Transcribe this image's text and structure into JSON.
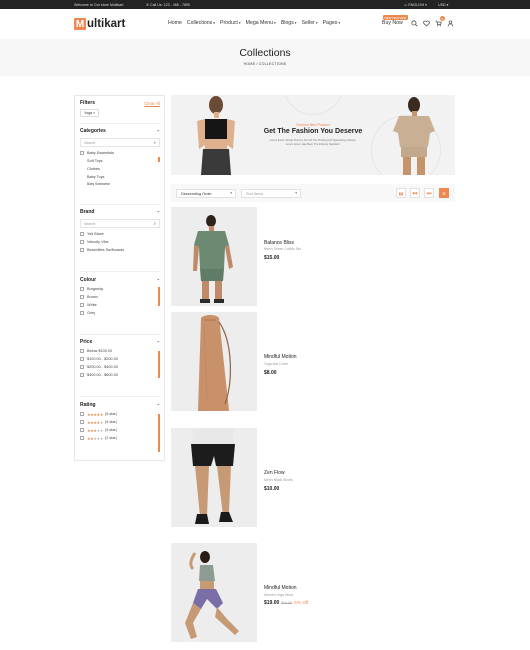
{
  "topbar": {
    "welcome": "Welcome to Our store Multikart",
    "call": "Call Us: 123 - 456 - 7890",
    "language": "ENGLISH",
    "currency": "USD"
  },
  "header": {
    "logo_mark": "M",
    "logo_text": "ultikart",
    "nav": [
      "Home",
      "Collections",
      "Product",
      "Mega Menu",
      "Blogs",
      "Seller",
      "Pages"
    ],
    "new_badge": "NEW FEATURE",
    "buy_now": "Buy Now",
    "cart_count": "0"
  },
  "page_title": "Collections",
  "breadcrumb": "HOME / COLLECTIONS",
  "filters": {
    "title": "Filters",
    "clear_all": "Clear All",
    "active_chip": "Yoga",
    "categories": {
      "title": "Categories",
      "search_placeholder": "Search",
      "items": [
        "Baby Essentials",
        "Soft Toys",
        "Clothes",
        "Baby Toys",
        "Baby Swimwear"
      ]
    },
    "brand": {
      "title": "Brand",
      "search_placeholder": "Search",
      "items": [
        "Yoti Blaze",
        "Velocity Vibe",
        "Beachlites Surfboards"
      ]
    },
    "colour": {
      "title": "Colour",
      "items": [
        "Burgundy",
        "Brown",
        "White",
        "Grey"
      ]
    },
    "price": {
      "title": "Price",
      "items": [
        "Below $100.00",
        "$100.00 - $200.00",
        "$200.00 - $400.00",
        "$400.00 - $600.00"
      ]
    },
    "rating": {
      "title": "Rating",
      "items": [
        {
          "label": "(5 star)",
          "stars": 5
        },
        {
          "label": "(4 star)",
          "stars": 4
        },
        {
          "label": "(3 star)",
          "stars": 3
        },
        {
          "label": "(2 star)",
          "stars": 2
        }
      ]
    }
  },
  "banner": {
    "subtitle": "Fashion Best Product",
    "title": "Get The Fashion You Deserve",
    "description": "Lorem Ipsum Simply Dummy Text Of The Printing And Typesetting Industry. Lorem Ipsum Has Been The Industry Standard."
  },
  "toolbar": {
    "sort": "Descending Order",
    "filter_placeholder": "Sort Items"
  },
  "products": [
    {
      "name": "Balance Bliss",
      "category": "Men's Green Crinkle Set",
      "price": "$15.00"
    },
    {
      "name": "Mindful Motion",
      "category": "Yoga Mat Cover",
      "price": "$8.00"
    },
    {
      "name": "Zen Flow",
      "category": "Men's Black Shorts",
      "price": "$10.00"
    },
    {
      "name": "Mindful Motion",
      "category": "Women Yoga Wear",
      "price": "$19.00",
      "old_price": "$20.00",
      "discount": "5% Off"
    }
  ],
  "colors": {
    "accent": "#ec8951",
    "dark": "#232323",
    "light_bg": "#f7f7f7"
  }
}
